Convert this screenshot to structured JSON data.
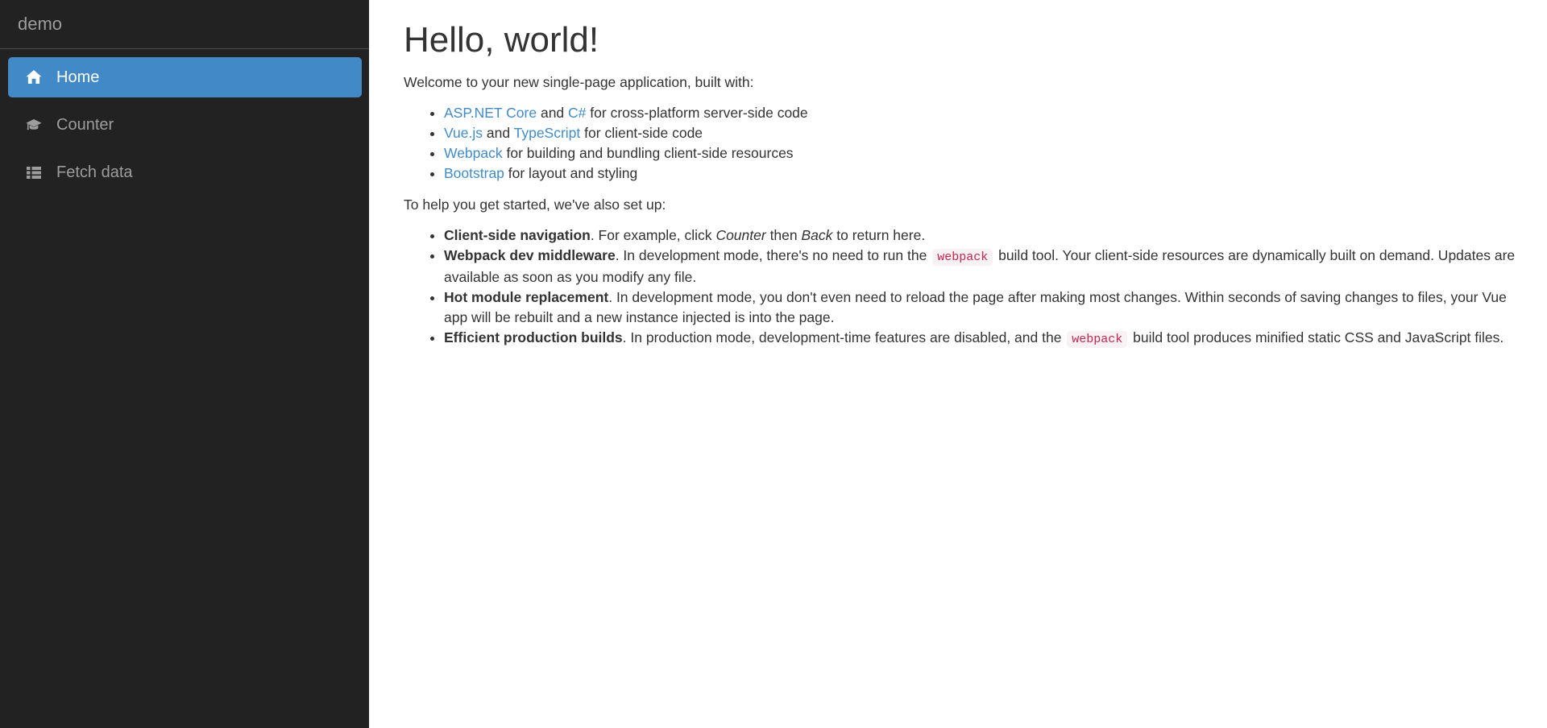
{
  "colors": {
    "sidebar_bg": "#222222",
    "active_item_bg": "#4189C7",
    "link": "#428bca",
    "code_fg": "#c7254e",
    "code_bg": "#f9f2f4"
  },
  "sidebar": {
    "brand": "demo",
    "items": [
      {
        "label": "Home",
        "icon": "home-icon",
        "active": true
      },
      {
        "label": "Counter",
        "icon": "graduation-cap-icon",
        "active": false
      },
      {
        "label": "Fetch data",
        "icon": "th-list-icon",
        "active": false
      }
    ]
  },
  "main": {
    "heading": "Hello, world!",
    "intro": "Welcome to your new single-page application, built with:",
    "tech_list": [
      {
        "segments": [
          {
            "type": "link",
            "text": "ASP.NET Core"
          },
          {
            "type": "text",
            "text": " and "
          },
          {
            "type": "link",
            "text": "C#"
          },
          {
            "type": "text",
            "text": " for cross-platform server-side code"
          }
        ]
      },
      {
        "segments": [
          {
            "type": "link",
            "text": "Vue.js"
          },
          {
            "type": "text",
            "text": " and "
          },
          {
            "type": "link",
            "text": "TypeScript"
          },
          {
            "type": "text",
            "text": " for client-side code"
          }
        ]
      },
      {
        "segments": [
          {
            "type": "link",
            "text": "Webpack"
          },
          {
            "type": "text",
            "text": " for building and bundling client-side resources"
          }
        ]
      },
      {
        "segments": [
          {
            "type": "link",
            "text": "Bootstrap"
          },
          {
            "type": "text",
            "text": " for layout and styling"
          }
        ]
      }
    ],
    "setup_intro": "To help you get started, we've also set up:",
    "setup_list": [
      {
        "segments": [
          {
            "type": "bold",
            "text": "Client-side navigation"
          },
          {
            "type": "text",
            "text": ". For example, click "
          },
          {
            "type": "italic",
            "text": "Counter"
          },
          {
            "type": "text",
            "text": " then "
          },
          {
            "type": "italic",
            "text": "Back"
          },
          {
            "type": "text",
            "text": " to return here."
          }
        ]
      },
      {
        "segments": [
          {
            "type": "bold",
            "text": "Webpack dev middleware"
          },
          {
            "type": "text",
            "text": ". In development mode, there's no need to run the "
          },
          {
            "type": "code",
            "text": "webpack"
          },
          {
            "type": "text",
            "text": " build tool. Your client-side resources are dynamically built on demand. Updates are available as soon as you modify any file."
          }
        ]
      },
      {
        "segments": [
          {
            "type": "bold",
            "text": "Hot module replacement"
          },
          {
            "type": "text",
            "text": ". In development mode, you don't even need to reload the page after making most changes. Within seconds of saving changes to files, your Vue app will be rebuilt and a new instance injected is into the page."
          }
        ]
      },
      {
        "segments": [
          {
            "type": "bold",
            "text": "Efficient production builds"
          },
          {
            "type": "text",
            "text": ". In production mode, development-time features are disabled, and the "
          },
          {
            "type": "code",
            "text": "webpack"
          },
          {
            "type": "text",
            "text": " build tool produces minified static CSS and JavaScript files."
          }
        ]
      }
    ]
  }
}
